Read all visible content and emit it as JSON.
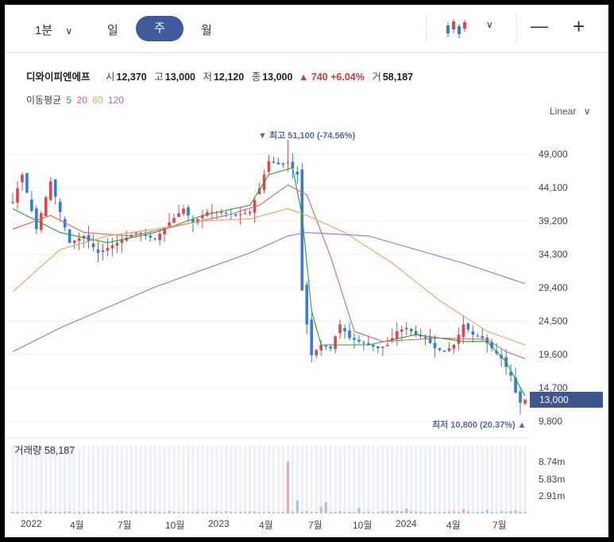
{
  "toolbar": {
    "interval_label": "1분",
    "tabs": [
      "일",
      "주",
      "월"
    ],
    "active_tab": "주",
    "chart_type_icon": "candlestick-icon",
    "zoom_out_label": "—",
    "zoom_in_label": "+"
  },
  "info": {
    "name": "디와이피엔에프",
    "open_label": "시",
    "open": "12,370",
    "high_label": "고",
    "high": "13,000",
    "low_label": "저",
    "low": "12,120",
    "close_label": "종",
    "close": "13,000",
    "change": "▲ 740 +6.04%",
    "volume_label": "거",
    "volume": "58,187"
  },
  "ma": {
    "label": "이동평균",
    "periods": [
      "5",
      "20",
      "60",
      "120"
    ],
    "colors": [
      "#2ca02c",
      "#e0616a",
      "#f2a05c",
      "#a66ce0"
    ]
  },
  "scale_label": "Linear",
  "colors": {
    "up": "#e0464e",
    "down": "#2f7fd6",
    "volume_up": "#f2a6aa",
    "volume_down": "#9cc8ee",
    "volume_bg": "#eef0f7"
  },
  "current_price_tag": "13,000",
  "annotations": {
    "high": "▼ 최고 51,100 (-74.56%)",
    "low": "최저 10,800 (20.37%) ▲"
  },
  "volume_title": "거래량 58,187",
  "chart_data": {
    "type": "candlestick",
    "y_ticks": [
      "49,000",
      "44,100",
      "39,200",
      "34,300",
      "29,400",
      "24,500",
      "19,600",
      "14,700",
      "9,800"
    ],
    "y_tick_values": [
      49000,
      44100,
      39200,
      34300,
      29400,
      24500,
      19600,
      14700,
      9800
    ],
    "volume_ticks": [
      "8.74m",
      "5.83m",
      "2.91m"
    ],
    "volume_tick_values": [
      8.74,
      5.83,
      2.91
    ],
    "x_ticks": [
      "2022",
      "4월",
      "7월",
      "10월",
      "2023",
      "4월",
      "7월",
      "10월",
      "2024",
      "4월",
      "7월"
    ],
    "highest": {
      "value": 51100,
      "change": "-74.56%"
    },
    "lowest": {
      "value": 10800,
      "change": "20.37%"
    },
    "last": {
      "open": 12370,
      "high": 13000,
      "low": 12120,
      "close": 13000,
      "volume": 58187
    },
    "close_path": [
      [
        0,
        42000
      ],
      [
        2,
        46000
      ],
      [
        5,
        38000
      ],
      [
        8,
        45000
      ],
      [
        12,
        36000
      ],
      [
        15,
        37000
      ],
      [
        18,
        34500
      ],
      [
        22,
        36000
      ],
      [
        26,
        37500
      ],
      [
        30,
        36500
      ],
      [
        33,
        39000
      ],
      [
        36,
        41000
      ],
      [
        38,
        39000
      ],
      [
        41,
        40500
      ],
      [
        44,
        40500
      ],
      [
        47,
        40000
      ],
      [
        50,
        40500
      ],
      [
        52,
        44000
      ],
      [
        54,
        48000
      ],
      [
        56,
        47500
      ],
      [
        58,
        47800
      ],
      [
        60,
        46000
      ],
      [
        61,
        29000
      ],
      [
        62,
        24000
      ],
      [
        63,
        19500
      ],
      [
        65,
        21000
      ],
      [
        67,
        20500
      ],
      [
        69,
        24000
      ],
      [
        71,
        22000
      ],
      [
        73,
        21500
      ],
      [
        75,
        21000
      ],
      [
        77,
        20500
      ],
      [
        79,
        21000
      ],
      [
        81,
        23000
      ],
      [
        83,
        23500
      ],
      [
        85,
        22500
      ],
      [
        87,
        22000
      ],
      [
        89,
        20500
      ],
      [
        91,
        20000
      ],
      [
        93,
        21000
      ],
      [
        95,
        24000
      ],
      [
        97,
        22500
      ],
      [
        99,
        22000
      ],
      [
        101,
        20500
      ],
      [
        103,
        19000
      ],
      [
        105,
        16500
      ],
      [
        106,
        14000
      ],
      [
        107,
        12500
      ],
      [
        108,
        13000
      ]
    ],
    "moving_averages": [
      {
        "name": "5",
        "values": [
          [
            0,
            41000
          ],
          [
            10,
            37500
          ],
          [
            20,
            36000
          ],
          [
            30,
            37500
          ],
          [
            40,
            40000
          ],
          [
            50,
            41500
          ],
          [
            54,
            46000
          ],
          [
            59,
            47000
          ],
          [
            61,
            40000
          ],
          [
            63,
            26000
          ],
          [
            65,
            21000
          ],
          [
            75,
            21000
          ],
          [
            85,
            22500
          ],
          [
            95,
            21500
          ],
          [
            100,
            21500
          ],
          [
            104,
            18500
          ],
          [
            108,
            13500
          ]
        ]
      },
      {
        "name": "20",
        "values": [
          [
            0,
            38000
          ],
          [
            8,
            40000
          ],
          [
            15,
            37500
          ],
          [
            25,
            37000
          ],
          [
            35,
            38500
          ],
          [
            45,
            40000
          ],
          [
            52,
            41500
          ],
          [
            58,
            44500
          ],
          [
            62,
            43000
          ],
          [
            67,
            34000
          ],
          [
            72,
            23000
          ],
          [
            78,
            21500
          ],
          [
            90,
            22000
          ],
          [
            100,
            21800
          ],
          [
            104,
            20000
          ],
          [
            108,
            19000
          ]
        ]
      },
      {
        "name": "60",
        "values": [
          [
            0,
            28800
          ],
          [
            10,
            35000
          ],
          [
            20,
            37000
          ],
          [
            30,
            38000
          ],
          [
            40,
            39200
          ],
          [
            50,
            39500
          ],
          [
            58,
            41000
          ],
          [
            62,
            40000
          ],
          [
            70,
            37500
          ],
          [
            80,
            33000
          ],
          [
            90,
            27500
          ],
          [
            100,
            23000
          ],
          [
            108,
            21000
          ]
        ]
      },
      {
        "name": "120",
        "values": [
          [
            0,
            20000
          ],
          [
            10,
            23500
          ],
          [
            20,
            26500
          ],
          [
            30,
            29500
          ],
          [
            40,
            32000
          ],
          [
            50,
            34500
          ],
          [
            58,
            37000
          ],
          [
            62,
            37500
          ],
          [
            75,
            37000
          ],
          [
            85,
            35000
          ],
          [
            95,
            33000
          ],
          [
            108,
            30000
          ]
        ]
      }
    ],
    "volume_spikes": [
      [
        58,
        8.74
      ],
      [
        60,
        2.2
      ],
      [
        66,
        1.9
      ],
      [
        65,
        1.1
      ],
      [
        73,
        0.9
      ],
      [
        83,
        0.8
      ],
      [
        95,
        0.7
      ],
      [
        100,
        0.6
      ],
      [
        106,
        0.5
      ]
    ]
  }
}
